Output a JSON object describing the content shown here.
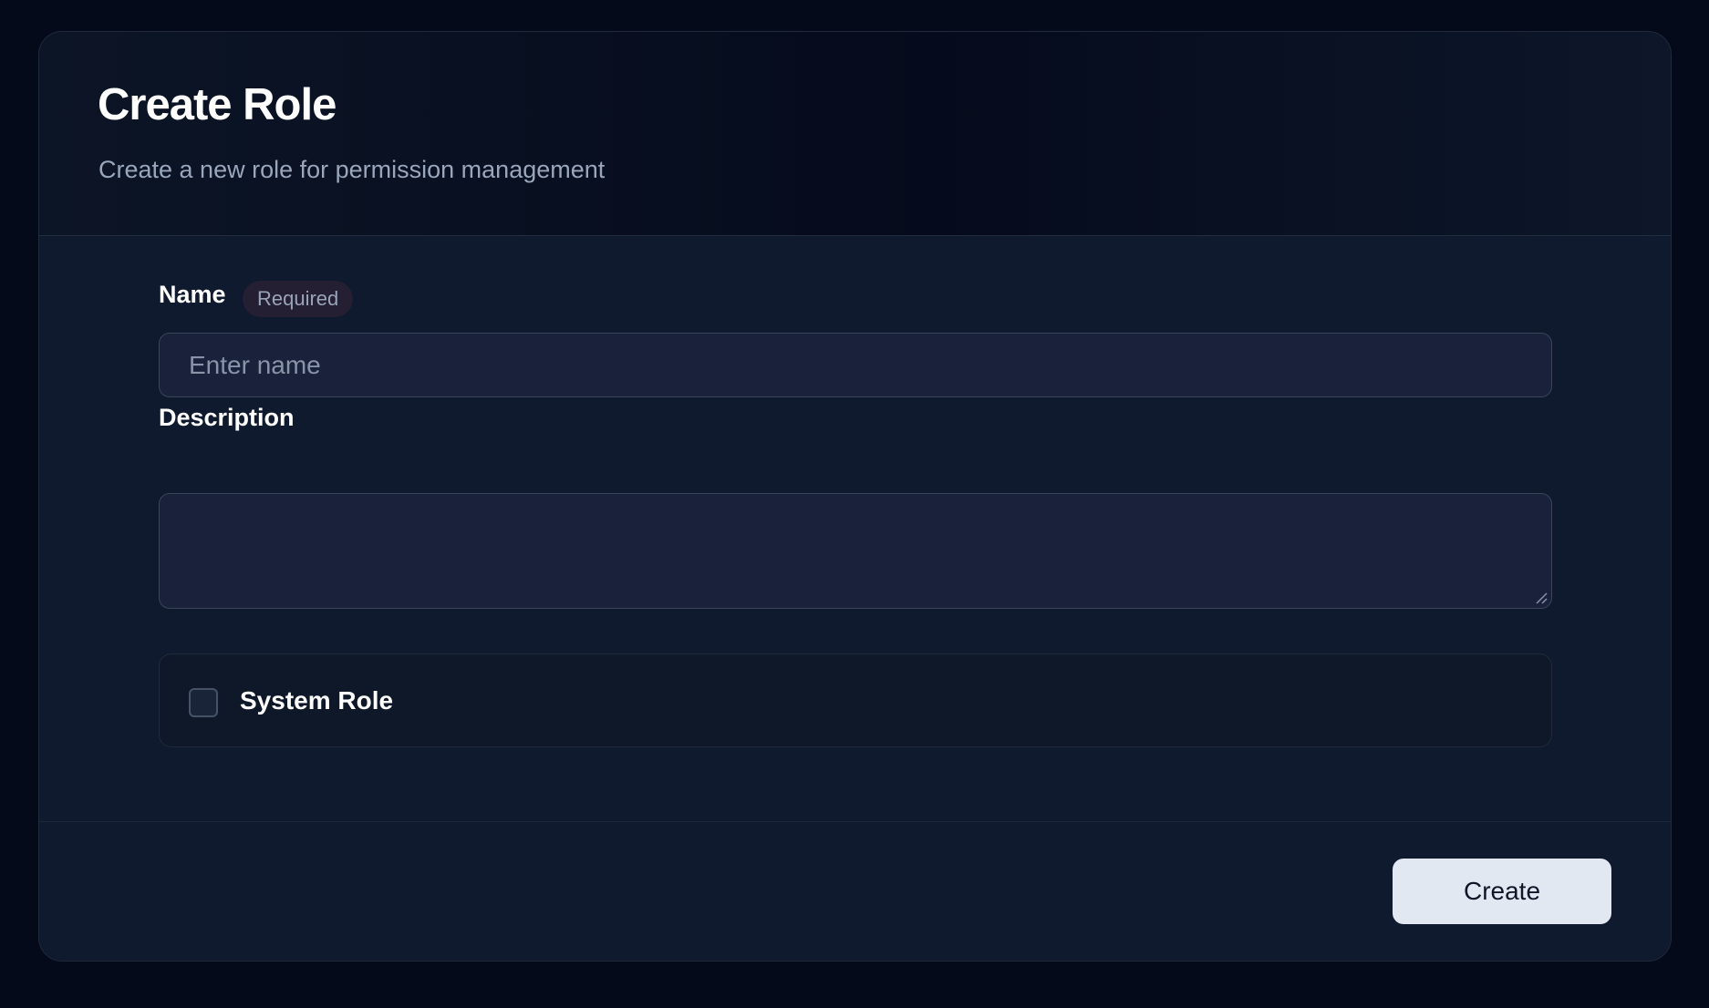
{
  "header": {
    "title": "Create Role",
    "subtitle": "Create a new role for permission management"
  },
  "form": {
    "name": {
      "label": "Name",
      "badge": "Required",
      "value": "",
      "placeholder": "Enter name"
    },
    "description": {
      "label": "Description",
      "value": ""
    },
    "system_role": {
      "label": "System Role",
      "checked": false
    }
  },
  "footer": {
    "create_label": "Create"
  },
  "colors": {
    "page_background": "#040a1a",
    "card_background": "#101a2e",
    "input_background": "#19223a",
    "badge_background": "#241f33",
    "button_background": "#e2e8f2"
  }
}
